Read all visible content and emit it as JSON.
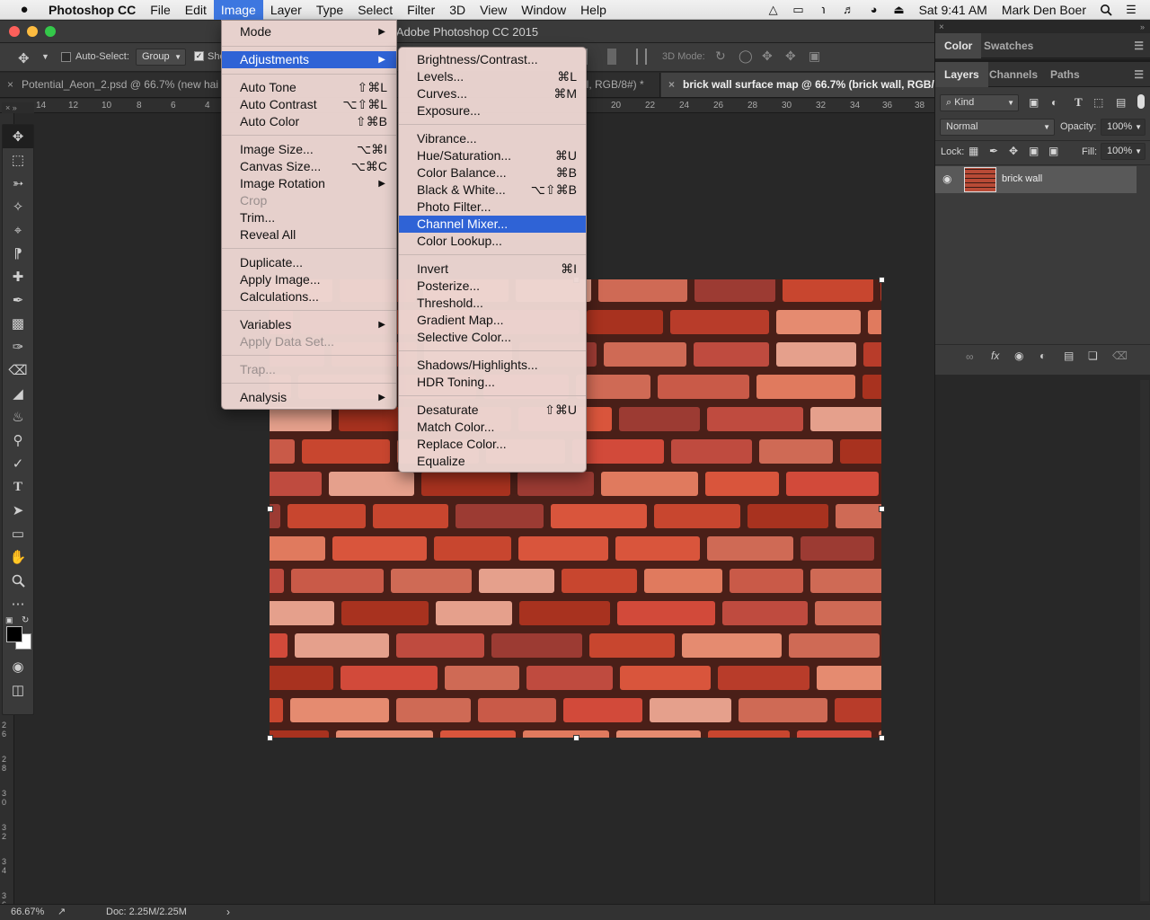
{
  "menubar": {
    "apple": "",
    "app_name": "Photoshop CC",
    "items": [
      "File",
      "Edit",
      "Image",
      "Layer",
      "Type",
      "Select",
      "Filter",
      "3D",
      "View",
      "Window",
      "Help"
    ],
    "active_item": "Image",
    "clock": "Sat 9:41 AM",
    "user": "Mark Den Boer"
  },
  "window": {
    "title": "Adobe Photoshop CC 2015"
  },
  "options_bar": {
    "auto_select_label": "Auto-Select:",
    "auto_select_value": "Group",
    "show_transform_label": "Sho",
    "mode_3d_label": "3D Mode:"
  },
  "doc_tabs": [
    {
      "label": "Potential_Aeon_2.psd @ 66.7% (new hai"
    },
    {
      "label": "ll, RGB/8#) *"
    },
    {
      "label": "brick wall surface map @ 66.7% (brick wall, RGB/8"
    }
  ],
  "ruler": {
    "h_ticks": [
      "14",
      "12",
      "10",
      "8",
      "6",
      "4",
      "20",
      "22",
      "24",
      "26",
      "28",
      "30",
      "32",
      "34",
      "36",
      "38"
    ],
    "v_ticks": [
      "2 6",
      "2 8",
      "3 0",
      "3 2",
      "3 4",
      "3 6"
    ]
  },
  "image_menu": {
    "items": [
      {
        "label": "Mode",
        "shortcut": "",
        "submenu": true,
        "disabled": false
      },
      {
        "label": "Adjustments",
        "shortcut": "",
        "submenu": true,
        "disabled": false,
        "highlighted": true
      },
      {
        "label": "Auto Tone",
        "shortcut": "⇧⌘L"
      },
      {
        "label": "Auto Contrast",
        "shortcut": "⌥⇧⌘L"
      },
      {
        "label": "Auto Color",
        "shortcut": "⇧⌘B"
      },
      {
        "label": "Image Size...",
        "shortcut": "⌥⌘I"
      },
      {
        "label": "Canvas Size...",
        "shortcut": "⌥⌘C"
      },
      {
        "label": "Image Rotation",
        "shortcut": "",
        "submenu": true
      },
      {
        "label": "Crop",
        "shortcut": "",
        "disabled": true
      },
      {
        "label": "Trim...",
        "shortcut": ""
      },
      {
        "label": "Reveal All",
        "shortcut": ""
      },
      {
        "label": "Duplicate...",
        "shortcut": ""
      },
      {
        "label": "Apply Image...",
        "shortcut": ""
      },
      {
        "label": "Calculations...",
        "shortcut": ""
      },
      {
        "label": "Variables",
        "shortcut": "",
        "submenu": true
      },
      {
        "label": "Apply Data Set...",
        "shortcut": "",
        "disabled": true
      },
      {
        "label": "Trap...",
        "shortcut": "",
        "disabled": true
      },
      {
        "label": "Analysis",
        "shortcut": "",
        "submenu": true
      }
    ]
  },
  "adjustments_menu": {
    "items": [
      {
        "label": "Brightness/Contrast...",
        "shortcut": ""
      },
      {
        "label": "Levels...",
        "shortcut": "⌘L"
      },
      {
        "label": "Curves...",
        "shortcut": "⌘M"
      },
      {
        "label": "Exposure...",
        "shortcut": ""
      },
      {
        "label": "Vibrance...",
        "shortcut": ""
      },
      {
        "label": "Hue/Saturation...",
        "shortcut": "⌘U"
      },
      {
        "label": "Color Balance...",
        "shortcut": "⌘B"
      },
      {
        "label": "Black & White...",
        "shortcut": "⌥⇧⌘B"
      },
      {
        "label": "Photo Filter...",
        "shortcut": ""
      },
      {
        "label": "Channel Mixer...",
        "shortcut": "",
        "highlighted": true
      },
      {
        "label": "Color Lookup...",
        "shortcut": ""
      },
      {
        "label": "Invert",
        "shortcut": "⌘I"
      },
      {
        "label": "Posterize...",
        "shortcut": ""
      },
      {
        "label": "Threshold...",
        "shortcut": ""
      },
      {
        "label": "Gradient Map...",
        "shortcut": ""
      },
      {
        "label": "Selective Color...",
        "shortcut": ""
      },
      {
        "label": "Shadows/Highlights...",
        "shortcut": ""
      },
      {
        "label": "HDR Toning...",
        "shortcut": ""
      },
      {
        "label": "Desaturate",
        "shortcut": "⇧⌘U"
      },
      {
        "label": "Match Color...",
        "shortcut": ""
      },
      {
        "label": "Replace Color...",
        "shortcut": ""
      },
      {
        "label": "Equalize",
        "shortcut": ""
      }
    ]
  },
  "color_panel": {
    "tabs": [
      "Color",
      "Swatches"
    ],
    "active": "Color"
  },
  "layers_panel": {
    "tabs": [
      "Layers",
      "Channels",
      "Paths"
    ],
    "active": "Layers",
    "filter_kind": "Kind",
    "blend_mode": "Normal",
    "opacity_label": "Opacity:",
    "opacity_value": "100%",
    "lock_label": "Lock:",
    "fill_label": "Fill:",
    "fill_value": "100%",
    "layers": [
      {
        "name": "brick wall",
        "visible": true
      }
    ]
  },
  "status_bar": {
    "zoom": "66.67%",
    "doc_info": "Doc: 2.25M/2.25M"
  },
  "colors": {
    "menu_highlight": "#2f63d6",
    "menubar_active": "#3d77e0",
    "brick_dark": "#4a1f18",
    "brick_red": "#c8462f"
  }
}
